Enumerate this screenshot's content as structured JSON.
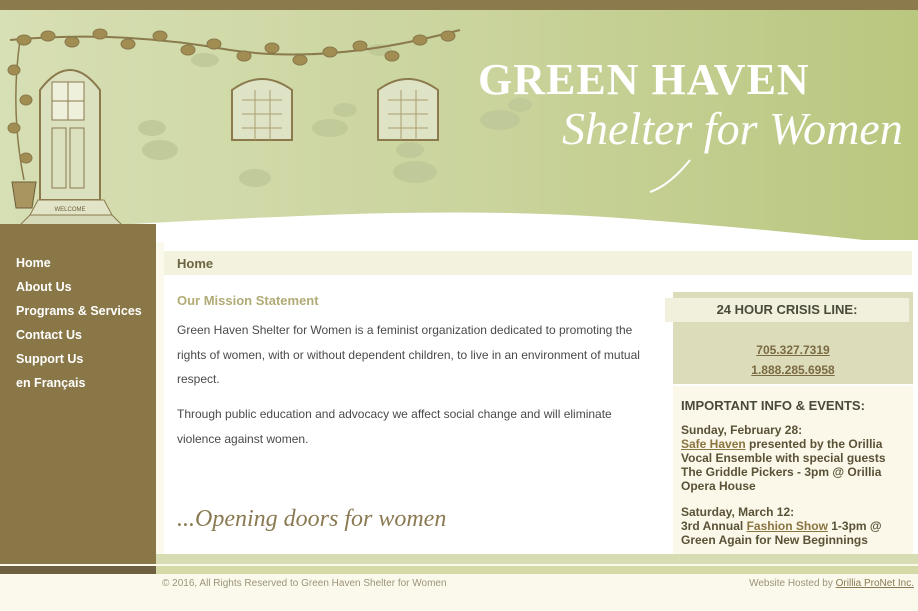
{
  "header": {
    "title": "GREEN HAVEN",
    "subtitle": "Shelter for Women",
    "door_mat_text": "WELCOME"
  },
  "nav": {
    "items": [
      {
        "label": "Home"
      },
      {
        "label": "About Us"
      },
      {
        "label": "Programs & Services"
      },
      {
        "label": "Contact Us"
      },
      {
        "label": "Support Us"
      },
      {
        "label": "en Français"
      }
    ]
  },
  "breadcrumb": {
    "label": "Home"
  },
  "mission": {
    "title": "Our Mission Statement",
    "paragraph1": "Green Haven Shelter for Women is a feminist organization dedicated to promoting the rights of women, with or without dependent children, to live in an environment of mutual respect.",
    "paragraph2": "Through public education and advocacy we affect social change and will eliminate violence against women.",
    "tagline": "...Opening doors for women"
  },
  "crisis": {
    "title": "24 HOUR CRISIS LINE:",
    "phone1": "705.327.7319",
    "phone2": "1.888.285.6958"
  },
  "events": {
    "title": "IMPORTANT INFO & EVENTS:",
    "event1": {
      "date": "Sunday, February 28:",
      "link": "Safe Haven",
      "text": " presented by the Orillia Vocal Ensemble with special guests The Griddle Pickers - 3pm @ Orillia Opera House"
    },
    "event2": {
      "date": "Saturday, March 12:",
      "prefix": "3rd Annual ",
      "link": "Fashion Show",
      "text": " 1-3pm @ Green Again for New Beginnings"
    }
  },
  "footer": {
    "copyright": "© 2016, All Rights Reserved to Green Haven Shelter for Women",
    "hosted_prefix": "Website Hosted by ",
    "hosted_link": "Orillia ProNet Inc."
  },
  "colors": {
    "sidebar": "#8a7747",
    "header_green": "#c9d39b",
    "link_brown": "#8a7440"
  }
}
